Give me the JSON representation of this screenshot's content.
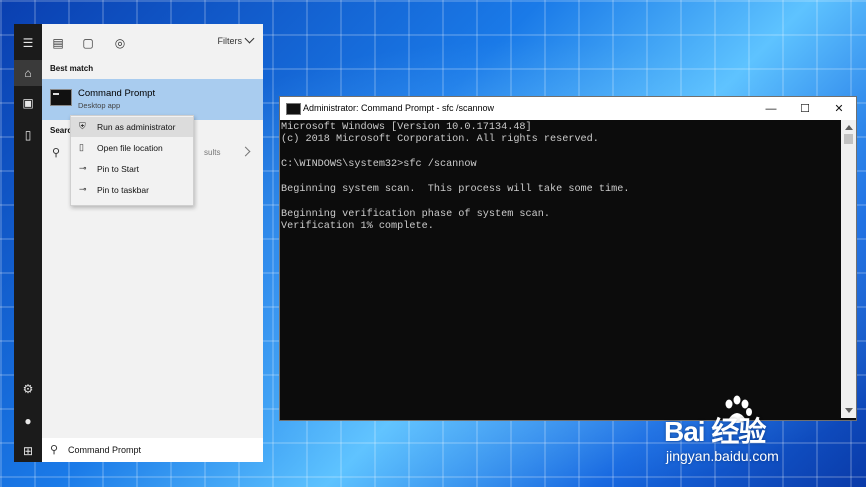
{
  "start_menu": {
    "filters_label": "Filters",
    "best_match_label": "Best match",
    "result": {
      "name": "Command Prompt",
      "type": "Desktop app"
    },
    "search_section_label": "Searc",
    "search_web_suffix": "sults",
    "context_menu": [
      {
        "icon": "admin-shield-icon",
        "label": "Run as administrator"
      },
      {
        "icon": "file-location-icon",
        "label": "Open file location"
      },
      {
        "icon": "pin-icon",
        "label": "Pin to Start"
      },
      {
        "icon": "pin-icon",
        "label": "Pin to taskbar"
      }
    ],
    "search_box_value": "Command Prompt"
  },
  "cmd_window": {
    "title": "Administrator: Command Prompt - sfc  /scannow",
    "console_lines": [
      "Microsoft Windows [Version 10.0.17134.48]",
      "(c) 2018 Microsoft Corporation. All rights reserved.",
      "",
      "C:\\WINDOWS\\system32>sfc /scannow",
      "",
      "Beginning system scan.  This process will take some time.",
      "",
      "Beginning verification phase of system scan.",
      "Verification 1% complete."
    ]
  },
  "watermark": {
    "brand": "Bai 经验",
    "url": "jingyan.baidu.com"
  }
}
